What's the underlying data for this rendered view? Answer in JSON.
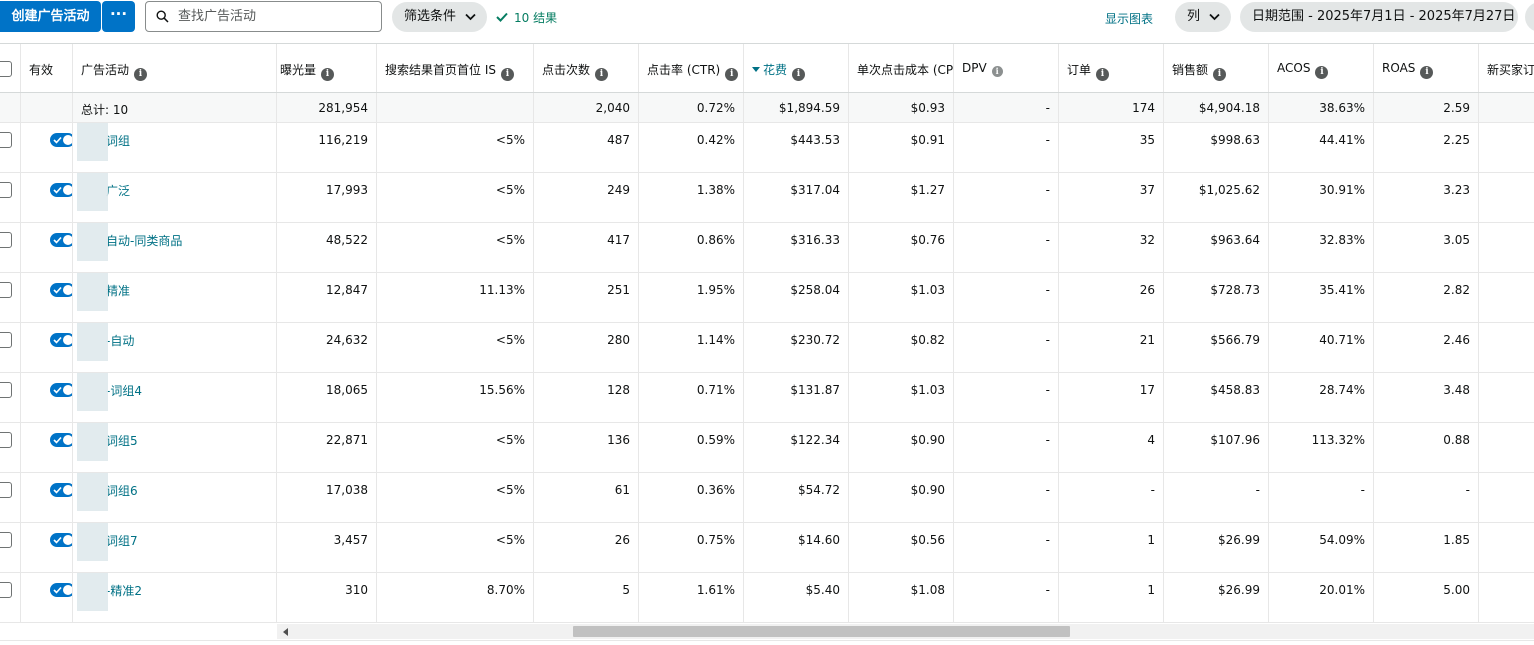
{
  "toolbar": {
    "create_label": "创建广告活动",
    "more_label": "···",
    "search_placeholder": "查找广告活动",
    "filter_label": "筛选条件",
    "result_count": "10 结果",
    "show_chart_label": "显示图表",
    "columns_label": "列",
    "date_range_label": "日期范围 - 2025年7月1日 - 2025年7月27日"
  },
  "colors": {
    "primary": "#0073c7",
    "link": "#007185",
    "success": "#067d62",
    "pill": "#e3e6e6"
  },
  "icons": {
    "search": "search-icon",
    "chevron": "chevron-down-icon",
    "check": "checkmark-icon",
    "info": "info-icon"
  },
  "table": {
    "headers": {
      "active": "有效",
      "campaign": "广告活动",
      "impressions": "曝光量",
      "top_is": "搜索结果首页首位 IS",
      "clicks": "点击次数",
      "ctr": "点击率 (CTR)",
      "spend": "花费",
      "cpc": "单次点击成本 (CPC)",
      "dpv": "DPV",
      "orders": "订单",
      "sales": "销售额",
      "acos": "ACOS",
      "roas": "ROAS",
      "new_buyers": "新买家订"
    },
    "totals": {
      "label": "总计: 10",
      "impressions": "281,954",
      "top_is": "",
      "clicks": "2,040",
      "ctr": "0.72%",
      "spend": "$1,894.59",
      "cpc": "$0.93",
      "dpv": "-",
      "orders": "174",
      "sales": "$4,904.18",
      "acos": "38.63%",
      "roas": "2.59"
    },
    "rows": [
      {
        "campaign": "词组",
        "impressions": "116,219",
        "top_is": "<5%",
        "clicks": "487",
        "ctr": "0.42%",
        "spend": "$443.53",
        "cpc": "$0.91",
        "dpv": "-",
        "orders": "35",
        "sales": "$998.63",
        "acos": "44.41%",
        "roas": "2.25"
      },
      {
        "campaign": "广泛",
        "impressions": "17,993",
        "top_is": "<5%",
        "clicks": "249",
        "ctr": "1.38%",
        "spend": "$317.04",
        "cpc": "$1.27",
        "dpv": "-",
        "orders": "37",
        "sales": "$1,025.62",
        "acos": "30.91%",
        "roas": "3.23"
      },
      {
        "campaign": "自动-同类商品",
        "impressions": "48,522",
        "top_is": "<5%",
        "clicks": "417",
        "ctr": "0.86%",
        "spend": "$316.33",
        "cpc": "$0.76",
        "dpv": "-",
        "orders": "32",
        "sales": "$963.64",
        "acos": "32.83%",
        "roas": "3.05"
      },
      {
        "campaign": "精准",
        "impressions": "12,847",
        "top_is": "11.13%",
        "clicks": "251",
        "ctr": "1.95%",
        "spend": "$258.04",
        "cpc": "$1.03",
        "dpv": "-",
        "orders": "26",
        "sales": "$728.73",
        "acos": "35.41%",
        "roas": "2.82"
      },
      {
        "campaign": "-自动",
        "impressions": "24,632",
        "top_is": "<5%",
        "clicks": "280",
        "ctr": "1.14%",
        "spend": "$230.72",
        "cpc": "$0.82",
        "dpv": "-",
        "orders": "21",
        "sales": "$566.79",
        "acos": "40.71%",
        "roas": "2.46"
      },
      {
        "campaign": "-词组4",
        "impressions": "18,065",
        "top_is": "15.56%",
        "clicks": "128",
        "ctr": "0.71%",
        "spend": "$131.87",
        "cpc": "$1.03",
        "dpv": "-",
        "orders": "17",
        "sales": "$458.83",
        "acos": "28.74%",
        "roas": "3.48"
      },
      {
        "campaign": "词组5",
        "impressions": "22,871",
        "top_is": "<5%",
        "clicks": "136",
        "ctr": "0.59%",
        "spend": "$122.34",
        "cpc": "$0.90",
        "dpv": "-",
        "orders": "4",
        "sales": "$107.96",
        "acos": "113.32%",
        "roas": "0.88"
      },
      {
        "campaign": "词组6",
        "impressions": "17,038",
        "top_is": "<5%",
        "clicks": "61",
        "ctr": "0.36%",
        "spend": "$54.72",
        "cpc": "$0.90",
        "dpv": "-",
        "orders": "-",
        "sales": "-",
        "acos": "-",
        "roas": "-"
      },
      {
        "campaign": "词组7",
        "impressions": "3,457",
        "top_is": "<5%",
        "clicks": "26",
        "ctr": "0.75%",
        "spend": "$14.60",
        "cpc": "$0.56",
        "dpv": "-",
        "orders": "1",
        "sales": "$26.99",
        "acos": "54.09%",
        "roas": "1.85"
      },
      {
        "campaign": "-精准2",
        "impressions": "310",
        "top_is": "8.70%",
        "clicks": "5",
        "ctr": "1.61%",
        "spend": "$5.40",
        "cpc": "$1.08",
        "dpv": "-",
        "orders": "1",
        "sales": "$26.99",
        "acos": "20.01%",
        "roas": "5.00"
      }
    ]
  }
}
